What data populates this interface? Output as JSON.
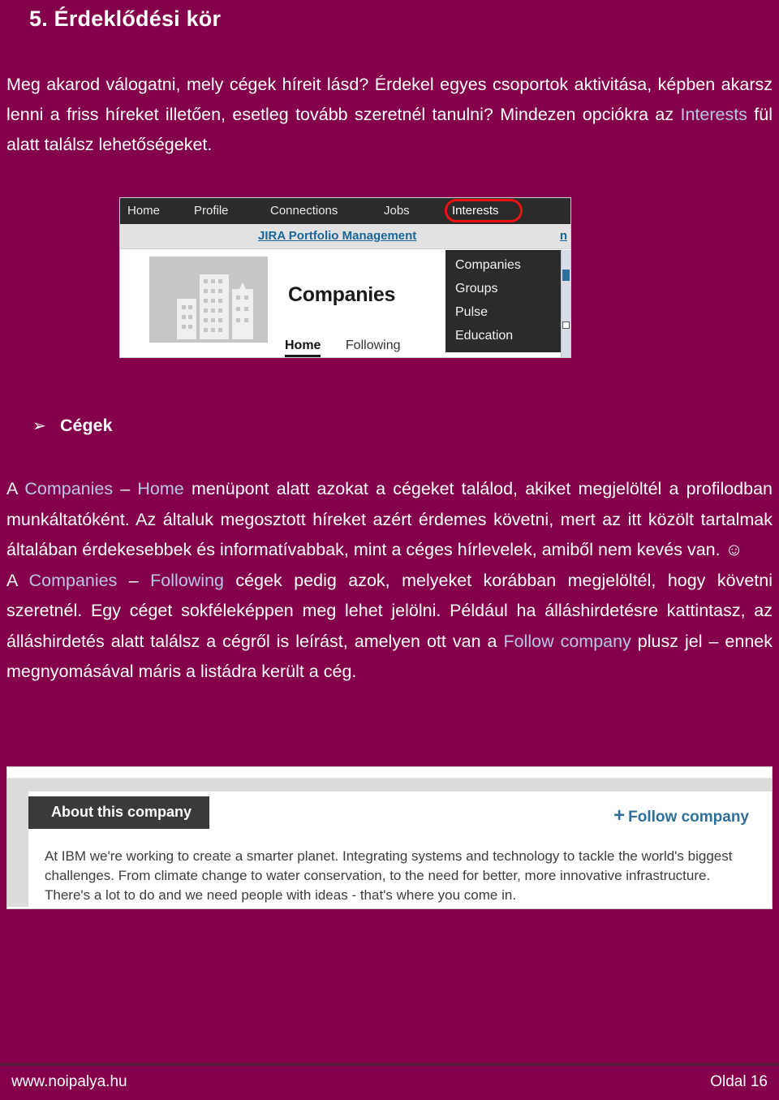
{
  "document": {
    "heading": "5. Érdeklődési kör",
    "background_color": "#85004B",
    "highlight_color": "#b9c6e8"
  },
  "intro": {
    "part1": "Meg akarod válogatni, mely cégek híreit lásd? Érdekel egyes csoportok aktivitása, képben akarsz lenni a friss híreket illetően, esetleg tovább szeretnél tanulni? Mindezen opciókra az ",
    "highlight": "Interests",
    "part2": " fül alatt találsz lehetőségeket."
  },
  "screenshot_top": {
    "nav": {
      "home": "Home",
      "profile": "Profile",
      "connections": "Connections",
      "jobs": "Jobs",
      "interests": "Interests",
      "highlight_ring_color": "#ee1111"
    },
    "promo_link": "JIRA Portfolio Management",
    "promo_tail": "n",
    "page_title": "Companies",
    "tabs": [
      {
        "label": "Home",
        "active": true
      },
      {
        "label": "Following",
        "active": false
      }
    ],
    "dropdown": {
      "items": [
        "Companies",
        "Groups",
        "Pulse",
        "Education"
      ]
    }
  },
  "bullet": {
    "glyph": "➢",
    "label": "Cégek"
  },
  "body": {
    "p1_a": "A ",
    "p1_hl1": "Companies",
    "p1_b": " – ",
    "p1_hl2": "Home",
    "p1_c": " menüpont alatt azokat a cégeket találod, akiket megjelöltél a profilodban munkáltatóként. Az általuk megosztott híreket azért érdemes követni, mert az itt közölt tartalmak általában érdekesebbek és informatívabbak, mint a céges hírlevelek, amiből nem kevés van. ☺",
    "p2_a": "A ",
    "p2_hl1": "Companies",
    "p2_b": " – ",
    "p2_hl2": "Following",
    "p2_c": " cégek pedig azok, melyeket korábban megjelöltél, hogy követni szeretnél. Egy céget sokféleképpen meg lehet jelölni. Például ha álláshirdetésre kattintasz, az álláshirdetés alatt találsz a cégről is leírást, amelyen ott van a ",
    "p2_hl3": "Follow company",
    "p2_d": " plusz jel – ennek megnyomásával máris a listádra került a cég."
  },
  "screenshot_bottom": {
    "about_tab": "About this company",
    "follow_button": {
      "plus": "+",
      "label": "Follow company",
      "color": "#2e6f99"
    },
    "description": "At IBM we're working to create a smarter planet. Integrating systems and technology to tackle the world's biggest challenges. From climate change to water conservation, to the need for better, more innovative infrastructure. There's a lot to do and we need people with ideas - that's where you come in."
  },
  "footer": {
    "site": "www.noipalya.hu",
    "page": "Oldal 16"
  }
}
